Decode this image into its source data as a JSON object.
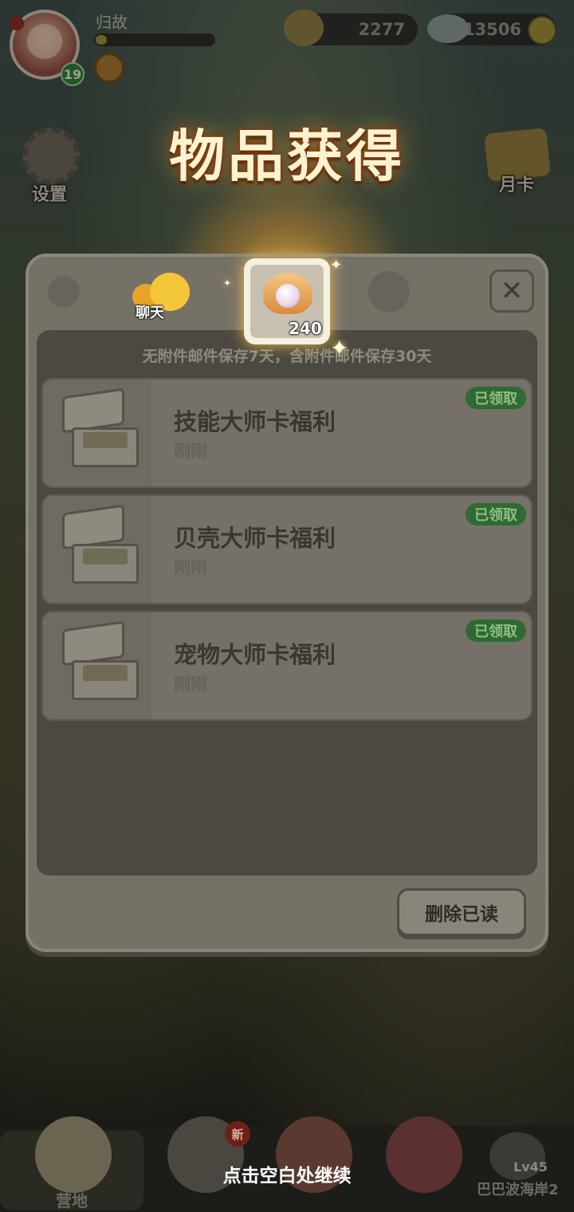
{
  "hud": {
    "player_name": "归故",
    "player_level": "19",
    "currency1_value": "2277",
    "currency2_value": "13506"
  },
  "side_buttons": {
    "settings_label": "设置",
    "monthly_card_label": "月卡"
  },
  "reward_popup": {
    "title": "物品获得",
    "item_name": "pearl-shell-icon",
    "item_quantity": "240",
    "continue_hint": "点击空白处继续"
  },
  "mail_panel": {
    "chat_label": "聊天",
    "retention_hint": "无附件邮件保存7天，含附件邮件保存30天",
    "close_icon": "close-icon",
    "mails": [
      {
        "title": "技能大师卡福利",
        "time": "刚刚",
        "status": "已领取"
      },
      {
        "title": "贝壳大师卡福利",
        "time": "刚刚",
        "status": "已领取"
      },
      {
        "title": "宠物大师卡福利",
        "time": "刚刚",
        "status": "已领取"
      }
    ],
    "delete_read_label": "删除已读"
  },
  "bottom_nav": {
    "camp_label": "营地",
    "new_badge": "新",
    "locked_level": "Lv45",
    "locked_area": "巴巴波海岸2"
  }
}
